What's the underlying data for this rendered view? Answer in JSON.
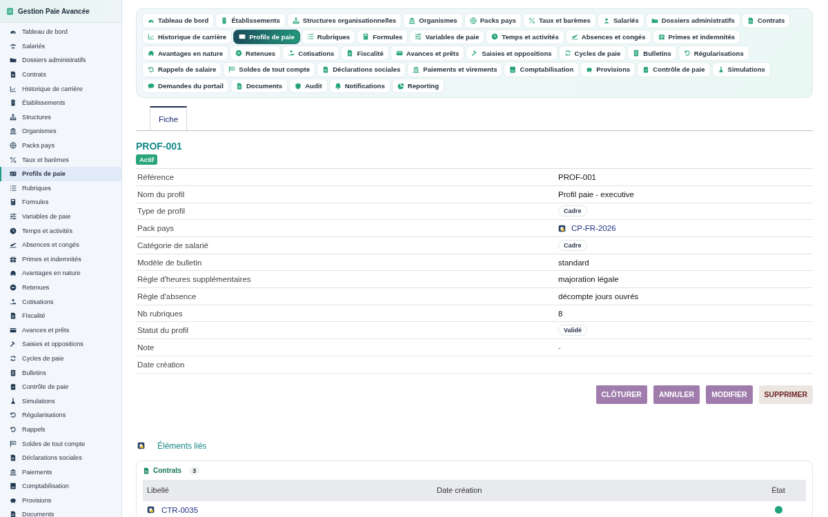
{
  "app": {
    "title": "Gestion Paie Avancée"
  },
  "sidebar": {
    "items": [
      {
        "label": "Tableau de bord",
        "selected": false
      },
      {
        "label": "Salariés",
        "selected": false
      },
      {
        "label": "Dossiers administratifs",
        "selected": false
      },
      {
        "label": "Contrats",
        "selected": false
      },
      {
        "label": "Historique de carrière",
        "selected": false
      },
      {
        "label": "Établissements",
        "selected": false
      },
      {
        "label": "Structures",
        "selected": false
      },
      {
        "label": "Organismes",
        "selected": false
      },
      {
        "label": "Packs pays",
        "selected": false
      },
      {
        "label": "Taux et barèmes",
        "selected": false
      },
      {
        "label": "Profils de paie",
        "selected": true
      },
      {
        "label": "Rubriques",
        "selected": false
      },
      {
        "label": "Formules",
        "selected": false
      },
      {
        "label": "Variables de paie",
        "selected": false
      },
      {
        "label": "Temps et activités",
        "selected": false
      },
      {
        "label": "Absences et congés",
        "selected": false
      },
      {
        "label": "Primes et indemnités",
        "selected": false
      },
      {
        "label": "Avantages en nature",
        "selected": false
      },
      {
        "label": "Retenues",
        "selected": false
      },
      {
        "label": "Cotisations",
        "selected": false
      },
      {
        "label": "Fiscalité",
        "selected": false
      },
      {
        "label": "Avances et prêts",
        "selected": false
      },
      {
        "label": "Saisies et oppositions",
        "selected": false
      },
      {
        "label": "Cycles de paie",
        "selected": false
      },
      {
        "label": "Bulletins",
        "selected": false
      },
      {
        "label": "Contrôle de paie",
        "selected": false
      },
      {
        "label": "Simulations",
        "selected": false
      },
      {
        "label": "Régularisations",
        "selected": false
      },
      {
        "label": "Rappels",
        "selected": false
      },
      {
        "label": "Soldes de tout compte",
        "selected": false
      },
      {
        "label": "Déclarations sociales",
        "selected": false
      },
      {
        "label": "Paiements",
        "selected": false
      },
      {
        "label": "Comptabilisation",
        "selected": false
      },
      {
        "label": "Provisions",
        "selected": false
      },
      {
        "label": "Documents",
        "selected": false
      }
    ]
  },
  "module_tabs": [
    {
      "label": "Tableau de bord",
      "selected": false
    },
    {
      "label": "Établissements",
      "selected": false
    },
    {
      "label": "Structures organisationnelles",
      "selected": false
    },
    {
      "label": "Organismes",
      "selected": false
    },
    {
      "label": "Packs pays",
      "selected": false
    },
    {
      "label": "Taux et barèmes",
      "selected": false
    },
    {
      "label": "Salariés",
      "selected": false
    },
    {
      "label": "Dossiers administratifs",
      "selected": false
    },
    {
      "label": "Contrats",
      "selected": false
    },
    {
      "label": "Historique de carrière",
      "selected": false
    },
    {
      "label": "Profils de paie",
      "selected": true
    },
    {
      "label": "Rubriques",
      "selected": false
    },
    {
      "label": "Formules",
      "selected": false
    },
    {
      "label": "Variables de paie",
      "selected": false
    },
    {
      "label": "Temps et activités",
      "selected": false
    },
    {
      "label": "Absences et congés",
      "selected": false
    },
    {
      "label": "Primes et indemnités",
      "selected": false
    },
    {
      "label": "Avantages en nature",
      "selected": false
    },
    {
      "label": "Retenues",
      "selected": false
    },
    {
      "label": "Cotisations",
      "selected": false
    },
    {
      "label": "Fiscalité",
      "selected": false
    },
    {
      "label": "Avances et prêts",
      "selected": false
    },
    {
      "label": "Saisies et oppositions",
      "selected": false
    },
    {
      "label": "Cycles de paie",
      "selected": false
    },
    {
      "label": "Bulletins",
      "selected": false
    },
    {
      "label": "Régularisations",
      "selected": false
    },
    {
      "label": "Rappels de salaire",
      "selected": false
    },
    {
      "label": "Soldes de tout compte",
      "selected": false
    },
    {
      "label": "Déclarations sociales",
      "selected": false
    },
    {
      "label": "Paiements et virements",
      "selected": false
    },
    {
      "label": "Comptabilisation",
      "selected": false
    },
    {
      "label": "Provisions",
      "selected": false
    },
    {
      "label": "Contrôle de paie",
      "selected": false
    },
    {
      "label": "Simulations",
      "selected": false
    },
    {
      "label": "Demandes du portail",
      "selected": false
    },
    {
      "label": "Documents",
      "selected": false
    },
    {
      "label": "Audit",
      "selected": false
    },
    {
      "label": "Notifications",
      "selected": false
    },
    {
      "label": "Reporting",
      "selected": false
    }
  ],
  "view_tabs": [
    {
      "label": "Fiche",
      "selected": true
    }
  ],
  "record": {
    "title": "PROF-001",
    "status": "Actif",
    "fields": [
      {
        "label": "Référence",
        "kind": "text",
        "value": "PROF-001"
      },
      {
        "label": "Nom du profil",
        "kind": "text",
        "value": "Profil paie - executive"
      },
      {
        "label": "Type de profil",
        "kind": "badge",
        "value": "Cadre"
      },
      {
        "label": "Pack pays",
        "kind": "link",
        "value": "CP-FR-2026"
      },
      {
        "label": "Catégorie de salarié",
        "kind": "badge",
        "value": "Cadre"
      },
      {
        "label": "Modèle de bulletin",
        "kind": "text",
        "value": "standard"
      },
      {
        "label": "Règle d'heures supplémentaires",
        "kind": "text",
        "value": "majoration légale"
      },
      {
        "label": "Règle d'absence",
        "kind": "text",
        "value": "décompte jours ouvrés"
      },
      {
        "label": "Nb rubriques",
        "kind": "text",
        "value": "8"
      },
      {
        "label": "Statut du profil",
        "kind": "badge",
        "value": "Validé"
      },
      {
        "label": "Note",
        "kind": "muted",
        "value": "-"
      },
      {
        "label": "Date création",
        "kind": "empty"
      }
    ]
  },
  "actions": [
    {
      "label": "CLÔTURER",
      "kind": "primary"
    },
    {
      "label": "ANNULER",
      "kind": "primary"
    },
    {
      "label": "MODIFIER",
      "kind": "primary"
    },
    {
      "label": "SUPPRIMER",
      "kind": "danger"
    }
  ],
  "related": {
    "title": "Éléments liés",
    "sections": [
      {
        "title": "Contrats",
        "count": "3",
        "columns": [
          "Libellé",
          "Date création",
          "État"
        ],
        "rows": [
          {
            "label": "CTR-0035",
            "color": "#22a27a"
          }
        ]
      }
    ]
  }
}
